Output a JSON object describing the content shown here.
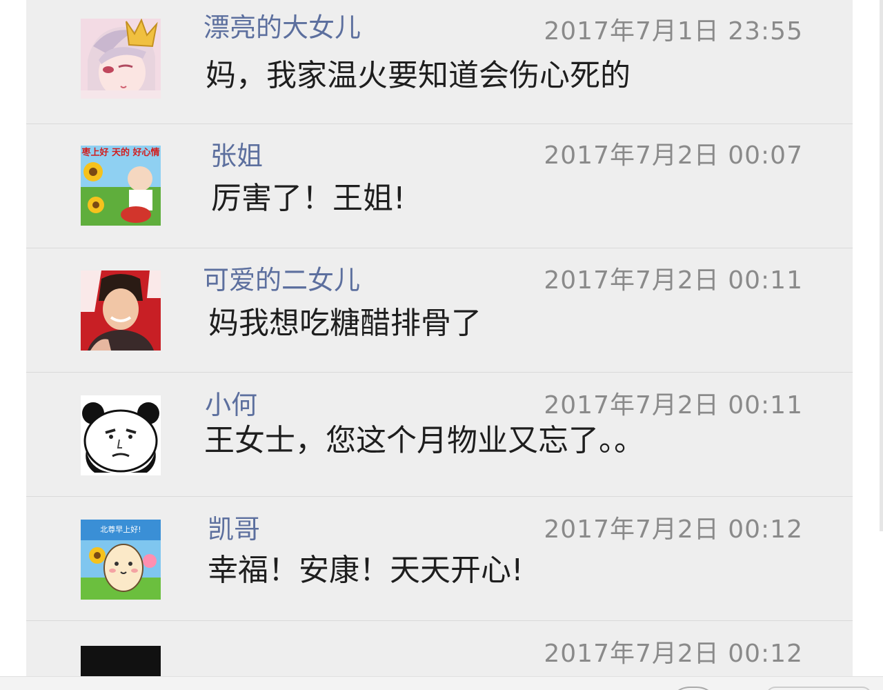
{
  "comments": [
    {
      "author": "漂亮的大女儿",
      "time": "2017年7月1日 23:55",
      "text": "妈，我家温火要知道会伤心死的",
      "avatar": "anime-boy-crown-icon"
    },
    {
      "author": "张姐",
      "time": "2017年7月2日 00:07",
      "text": "厉害了！王姐!",
      "avatar": "sunflower-child-greeting-icon",
      "avatar_text": "枣上好 天的 好心情"
    },
    {
      "author": "可爱的二女儿",
      "time": "2017年7月2日 00:11",
      "text": "妈我想吃糖醋排骨了",
      "avatar": "young-man-photo-icon"
    },
    {
      "author": "小何",
      "time": "2017年7月2日 00:11",
      "text": "王女士，您这个月物业又忘了。。",
      "avatar": "panda-meme-face-icon"
    },
    {
      "author": "凯哥",
      "time": "2017年7月2日 00:12",
      "text": "幸福！安康！天天开心!",
      "avatar": "egg-cartoon-sunflower-icon",
      "avatar_text": "北尊早上好!"
    },
    {
      "author": "",
      "time": "2017年7月2日 00:12",
      "text": "",
      "avatar": "black-avatar-icon"
    }
  ],
  "colors": {
    "background": "#eeeeee",
    "author": "#5c6f9e",
    "time": "#8a8a8a",
    "text": "#1e1e1e",
    "divider": "#d9d9d9"
  }
}
